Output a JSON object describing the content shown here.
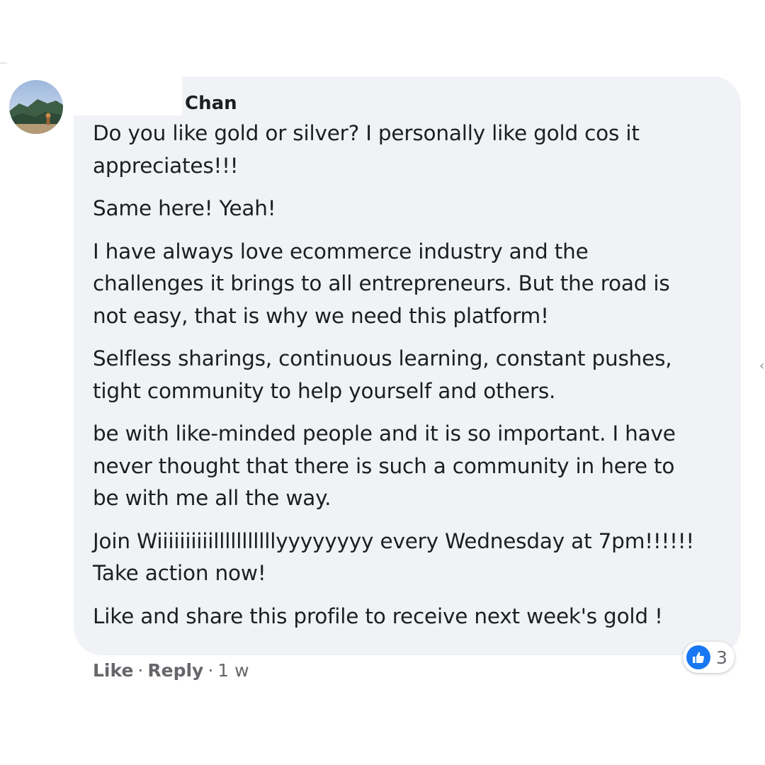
{
  "comment": {
    "author": "Chan",
    "paragraphs": [
      "Do you like gold or silver? I personally like gold cos it\nappreciates!!!",
      "Same here! Yeah!",
      "I have always love ecommerce industry and the\nchallenges it brings to all entrepreneurs. But the road is\nnot easy, that is why we need this platform!",
      "Selfless sharings, continuous learning, constant pushes,\ntight community to help yourself and others.",
      "be with like-minded people and it is so important. I have\nnever thought that there is such a community in here to\nbe with me all the way.",
      "Join Wiiiiiiiiiilllllllllllyyyyyyyy every Wednesday at 7pm!!!!!!\nTake action now!",
      "Like and share this profile to receive next week's gold !"
    ]
  },
  "actions": {
    "like_label": "Like",
    "separator": "·",
    "reply_label": "Reply",
    "timestamp": "1 w"
  },
  "reactions": {
    "count": "3",
    "icon": "thumbs-up-icon",
    "color": "#1877f2"
  },
  "colors": {
    "bubble": "#f0f2f5",
    "text": "#1c1e21",
    "meta": "#65676b",
    "accent": "#1877f2"
  }
}
